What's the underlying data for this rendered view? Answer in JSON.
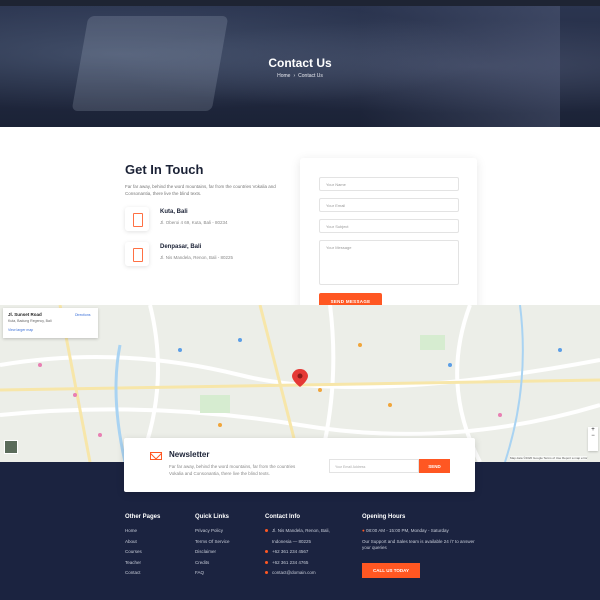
{
  "hero": {
    "title": "Contact Us",
    "breadcrumb": [
      "Home",
      "Contact Us"
    ]
  },
  "get_in_touch": {
    "title": "Get In Touch",
    "description": "Far far away, behind the word mountains, far from the countries Vokalia and Consonantia, there live the blind texts.",
    "locations": [
      {
        "name": "Kuta, Bali",
        "address": "Jl. Oberoi 4 69, Kuta, Bali - 80234"
      },
      {
        "name": "Denpasar, Bali",
        "address": "Jl. Nis Mandela, Renon, Bali - 80225"
      }
    ]
  },
  "form": {
    "name_placeholder": "Your Name",
    "email_placeholder": "Your Email",
    "subject_placeholder": "Your Subject",
    "message_placeholder": "Your Message",
    "send_label": "SEND MESSAGE"
  },
  "map": {
    "place_title": "Jl. Sunset Road",
    "place_sub": "Kuta, Badung Regency, Bali",
    "larger_map": "View larger map",
    "directions": "Directions",
    "footer_text": "Map data ©2020 Google  Terms of Use  Report a map error",
    "zoom_in": "+",
    "zoom_out": "−"
  },
  "newsletter": {
    "title": "Newsletter",
    "description": "Far far away, behind the word mountains, far from the countries Vokalia and Consonantia, there live the blind texts.",
    "input_placeholder": "Your Email Address",
    "button_label": "SEND"
  },
  "footer": {
    "other_pages": {
      "title": "Other Pages",
      "items": [
        "Home",
        "About",
        "Courses",
        "Teacher",
        "Contact"
      ]
    },
    "quick_links": {
      "title": "Quick Links",
      "items": [
        "Privacy Policy",
        "Terms Of Service",
        "Disclaimer",
        "Credits",
        "FAQ"
      ]
    },
    "contact_info": {
      "title": "Contact Info",
      "items": [
        "Jl. Nis Mandela, Renon, Bali,",
        "Indonesia — 80225",
        "+62 361 234 4567",
        "+62 361 234 4765",
        "contact@domain.com"
      ]
    },
    "opening_hours": {
      "title": "Opening Hours",
      "hours": "08:00 AM - 15:00 PM, Monday - Saturday",
      "description": "Our Support and Sales team is available 24 /7 to answer your queries",
      "cta_label": "CALL US TODAY"
    }
  },
  "colors": {
    "accent": "#ff5722",
    "dark": "#1b2340"
  }
}
